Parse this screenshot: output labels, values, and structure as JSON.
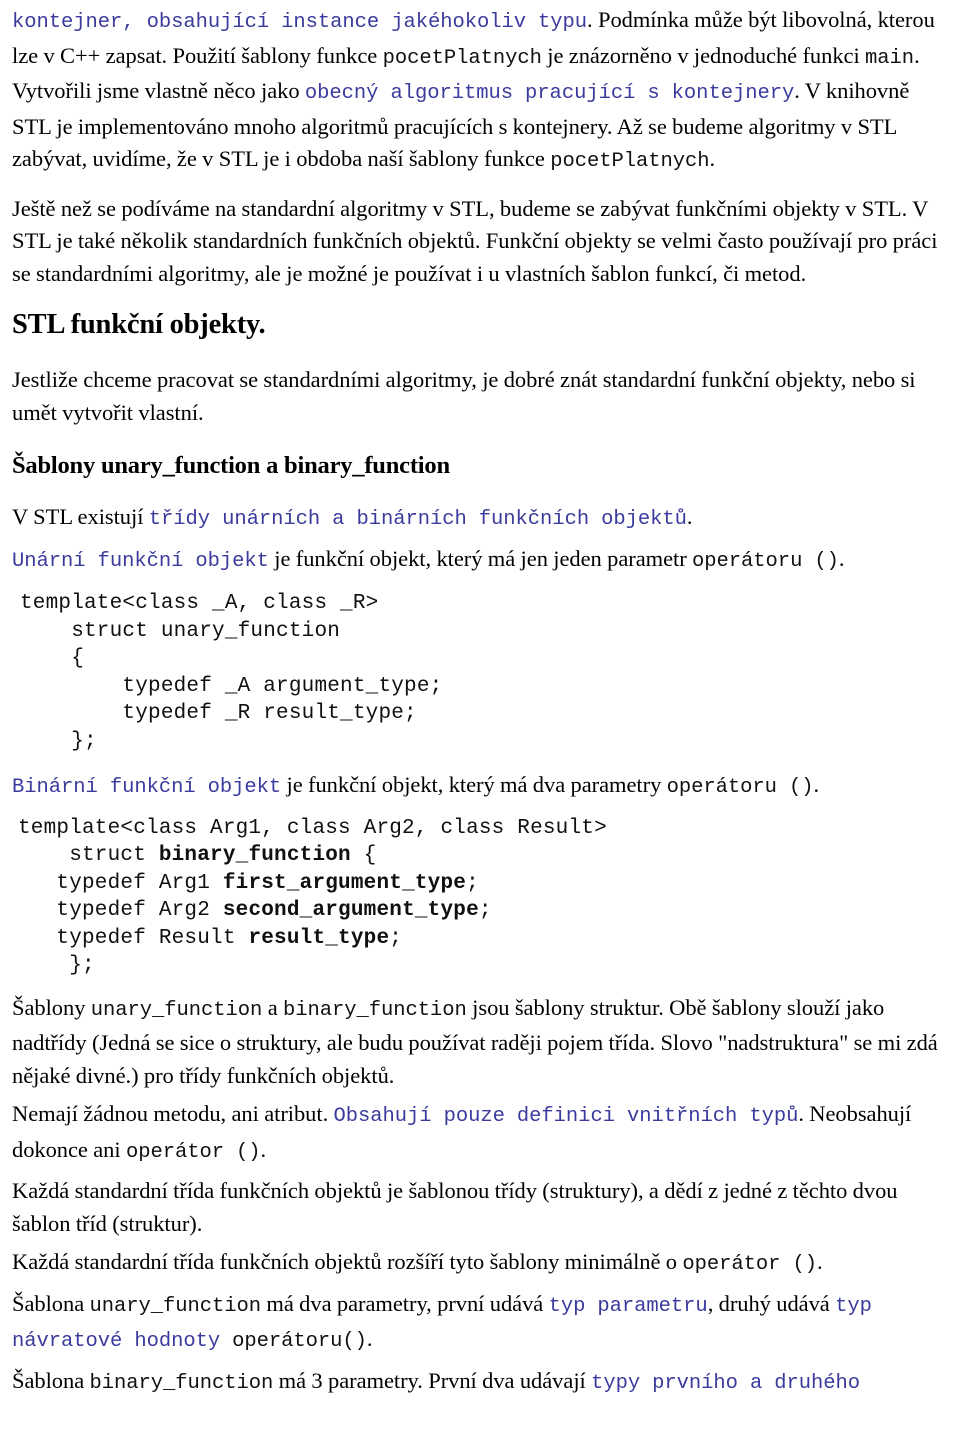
{
  "document": {
    "language": "cs",
    "colors": {
      "body_text": "#000000",
      "code_blue": "#3b3b9e",
      "code_black": "#111111",
      "background": "#ffffff"
    }
  },
  "paragraphs": {
    "p1": {
      "s1_code_blue": "kontejner, obsahující instance jakéhokoliv typu",
      "s2_text": ". Podmínka může být libovolná, kterou lze v C++ zapsat. Použití šablony funkce ",
      "s3_code": "pocetPlatnych",
      "s4_text": " je znázorněno v jednoduché funkci ",
      "s5_code": "main",
      "s6_text": ". Vytvořili jsme vlastně něco jako ",
      "s7_code_blue": "obecný algoritmus pracující s kontejnery",
      "s8_text": ". V knihovně STL je implementováno mnoho algoritmů pracujících s kontejnery. Až se budeme algoritmy v STL zabývat, uvidíme, že v STL je i obdoba naší šablony funkce ",
      "s9_code": "pocetPlatnych",
      "s10_text": "."
    },
    "p2": {
      "text": "Ještě než se podíváme na standardní algoritmy v STL, budeme se zabývat funkčními objekty v STL. V STL je také několik standardních funkčních objektů. Funkční objekty se velmi často používají pro práci se standardními algoritmy, ale je možné je používat i u vlastních šablon funkcí, či metod."
    },
    "p3": {
      "text": "Jestliže chceme pracovat se standardními algoritmy, je dobré znát standardní funkční objekty, nebo si umět vytvořit vlastní."
    },
    "p4": {
      "s1_text": "V STL existují ",
      "s2_code_blue": "třídy unárních a binárních funkčních objektů",
      "s3_text": "."
    },
    "p5": {
      "s1_code_blue": "Unární funkční objekt",
      "s2_text": " je funkční objekt, který má jen jeden parametr ",
      "s3_code": "operátoru ()",
      "s4_text": "."
    },
    "p6": {
      "s1_code_blue": "Binární funkční objekt",
      "s2_text": " je funkční objekt, který má dva parametry ",
      "s3_code": "operátoru ()",
      "s4_text": "."
    },
    "p7": {
      "s1_text": "Šablony ",
      "s2_code": "unary_function",
      "s3_text": " a ",
      "s4_code": "binary_function",
      "s5_text": " jsou šablony struktur. Obě šablony slouží jako nadtřídy (Jedná se sice o struktury, ale budu používat raději pojem třída. Slovo \"nadstruktura\" se mi zdá nějaké divné.) pro třídy funkčních objektů."
    },
    "p8": {
      "s1_text": "Nemají žádnou metodu, ani atribut. ",
      "s2_code_blue": "Obsahují pouze definici vnitřních typů",
      "s3_text": ". Neobsahují dokonce ani ",
      "s4_code": "operátor ()",
      "s5_text": "."
    },
    "p9": {
      "text": "Každá standardní třída funkčních objektů je šablonou třídy (struktury), a dědí z jedné z těchto dvou šablon tříd (struktur)."
    },
    "p10": {
      "s1_text": "Každá standardní třída funkčních objektů rozšíří tyto šablony minimálně o ",
      "s2_code": "operátor ()",
      "s3_text": "."
    },
    "p11": {
      "s1_text": "Šablona ",
      "s2_code": "unary_function",
      "s3_text": " má dva parametry, první udává ",
      "s4_code_blue": "typ parametru",
      "s5_text": ", druhý udává ",
      "s6_code_blue": "typ návratové hodnoty",
      "s7_code": " operátoru()",
      "s8_text": "."
    },
    "p12": {
      "s1_text": "Šablona ",
      "s2_code": "binary_function",
      "s3_text": " má 3 parametry. První dva udávají ",
      "s4_code_blue": "typy prvního a druhého"
    }
  },
  "headings": {
    "h1": "STL funkční objekty.",
    "h2": "Šablony unary_function a binary_function"
  },
  "code_blocks": {
    "unary_function": {
      "lines": [
        "template<class _A, class _R>",
        "    struct unary_function",
        "    {",
        "        typedef _A argument_type;",
        "        typedef _R result_type;",
        "    };"
      ]
    },
    "binary_function": {
      "line1_plain": "template<class Arg1, class Arg2, class Result>",
      "line2_pre": "    struct ",
      "line2_bold": "binary_function",
      "line2_post": " {",
      "line3_pre": "   typedef Arg1 ",
      "line3_bold": "first_argument_type",
      "line3_post": ";",
      "line4_pre": "   typedef Arg2 ",
      "line4_bold": "second_argument_type",
      "line4_post": ";",
      "line5_pre": "   typedef Result ",
      "line5_bold": "result_type",
      "line5_post": ";",
      "line6_plain": "    };"
    }
  }
}
